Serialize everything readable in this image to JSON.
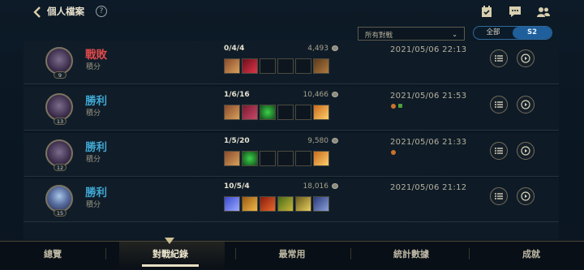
{
  "header": {
    "back_icon": "chevron-left-icon",
    "title": "個人檔案",
    "help_label": "?",
    "right_icons": [
      "calendar-check-icon",
      "chat-icon",
      "friends-icon"
    ]
  },
  "filter": {
    "dropdown_value": "所有對戰",
    "segment": [
      "全部",
      "S2"
    ],
    "segment_selected": "S2"
  },
  "matches": [
    {
      "result": "戰敗",
      "result_type": "lose",
      "mode": "積分",
      "level": "9",
      "kda": "0/4/4",
      "gold": "4,493",
      "date": "2021/05/06 22:13",
      "items": [
        "filled",
        "filled",
        "empty",
        "empty",
        "empty",
        "filled"
      ],
      "marks": []
    },
    {
      "result": "勝利",
      "result_type": "win",
      "mode": "積分",
      "level": "13",
      "kda": "1/6/16",
      "gold": "10,466",
      "date": "2021/05/06 21:53",
      "items": [
        "filled",
        "filled",
        "filled",
        "empty",
        "empty",
        "filled"
      ],
      "marks": [
        "orange",
        "green"
      ]
    },
    {
      "result": "勝利",
      "result_type": "win",
      "mode": "積分",
      "level": "12",
      "kda": "1/5/20",
      "gold": "9,580",
      "date": "2021/05/06 21:33",
      "items": [
        "filled",
        "filled",
        "empty",
        "empty",
        "empty",
        "filled"
      ],
      "marks": [
        "orange"
      ]
    },
    {
      "result": "勝利",
      "result_type": "win",
      "mode": "積分",
      "level": "15",
      "kda": "10/5/4",
      "gold": "18,016",
      "date": "2021/05/06 21:12",
      "items": [
        "filled",
        "filled",
        "filled",
        "filled",
        "filled",
        "filled"
      ],
      "marks": []
    }
  ],
  "tabs": [
    "總覽",
    "對戰紀錄",
    "最常用",
    "統計數據",
    "成就"
  ],
  "active_tab": "對戰紀錄",
  "colors": {
    "lose": "#e04a4a",
    "win": "#3fa6d0",
    "accent": "#1e5f9c"
  }
}
